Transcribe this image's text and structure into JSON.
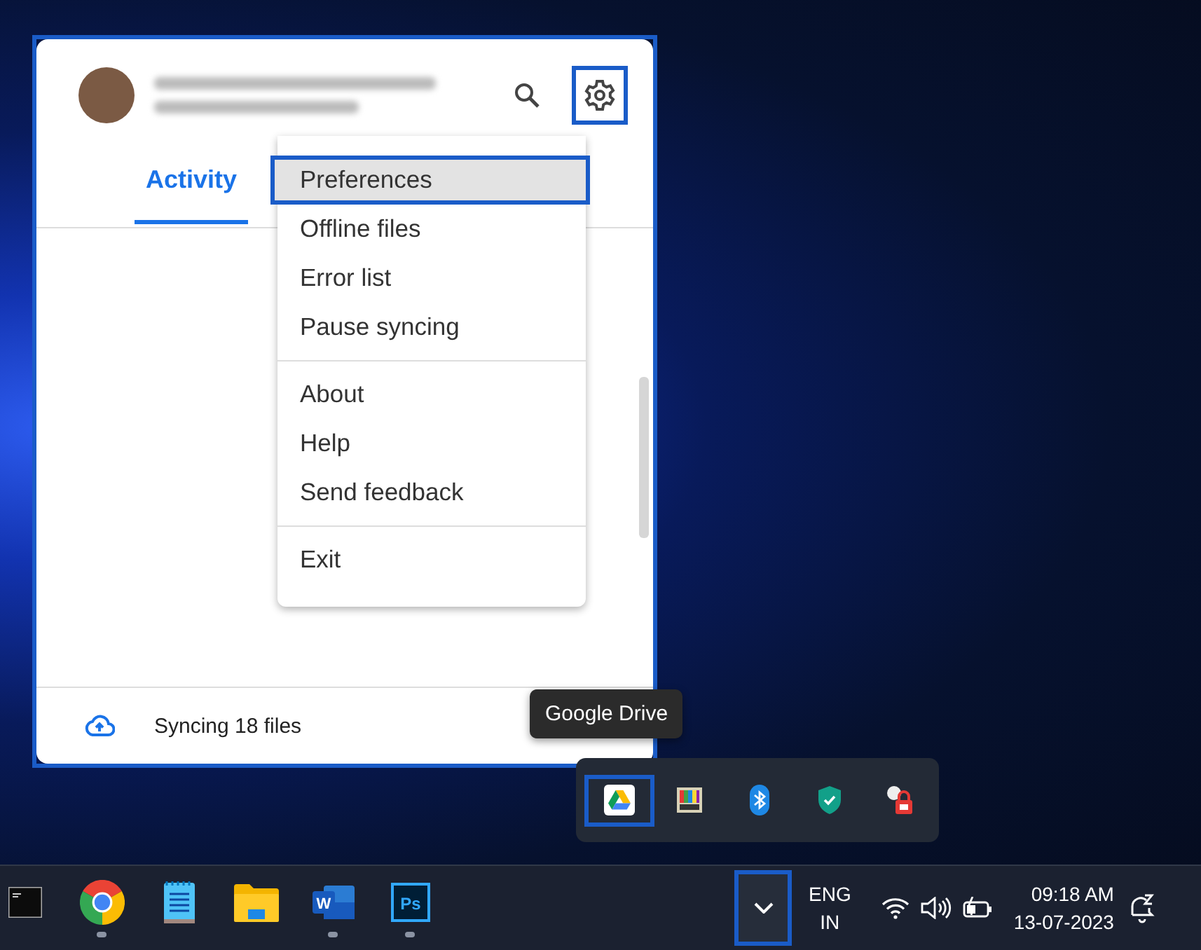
{
  "drive_panel": {
    "highlighted": true,
    "settings_highlighted": true,
    "tabs": [
      {
        "label": "Activity",
        "selected": true
      }
    ],
    "status": "Syncing 18 files"
  },
  "menu": {
    "groups": [
      [
        {
          "label": "Preferences",
          "selected": true,
          "highlighted": true
        },
        {
          "label": "Offline files",
          "selected": false,
          "highlighted": false
        },
        {
          "label": "Error list",
          "selected": false,
          "highlighted": false
        },
        {
          "label": "Pause syncing",
          "selected": false,
          "highlighted": false
        }
      ],
      [
        {
          "label": "About",
          "selected": false,
          "highlighted": false
        },
        {
          "label": "Help",
          "selected": false,
          "highlighted": false
        },
        {
          "label": "Send feedback",
          "selected": false,
          "highlighted": false
        }
      ],
      [
        {
          "label": "Exit",
          "selected": false,
          "highlighted": false
        }
      ]
    ]
  },
  "tooltip": "Google Drive",
  "tray_flyout": {
    "icons": [
      {
        "kind": "drive",
        "highlighted": true
      },
      {
        "kind": "monitor",
        "highlighted": false
      },
      {
        "kind": "bluetooth",
        "highlighted": false
      },
      {
        "kind": "shield",
        "highlighted": false
      },
      {
        "kind": "lock",
        "highlighted": false
      }
    ]
  },
  "taskbar": {
    "apps": [
      {
        "kind": "terminal",
        "running": false
      },
      {
        "kind": "chrome",
        "running": true
      },
      {
        "kind": "notepad",
        "running": false
      },
      {
        "kind": "folder",
        "running": false
      },
      {
        "kind": "word",
        "running": true,
        "label": "W"
      },
      {
        "kind": "photoshop",
        "running": true,
        "label": "Ps"
      }
    ],
    "overflow_highlighted": true,
    "language": "ENG",
    "region": "IN",
    "time": "09:18 AM",
    "date": "13-07-2023"
  }
}
